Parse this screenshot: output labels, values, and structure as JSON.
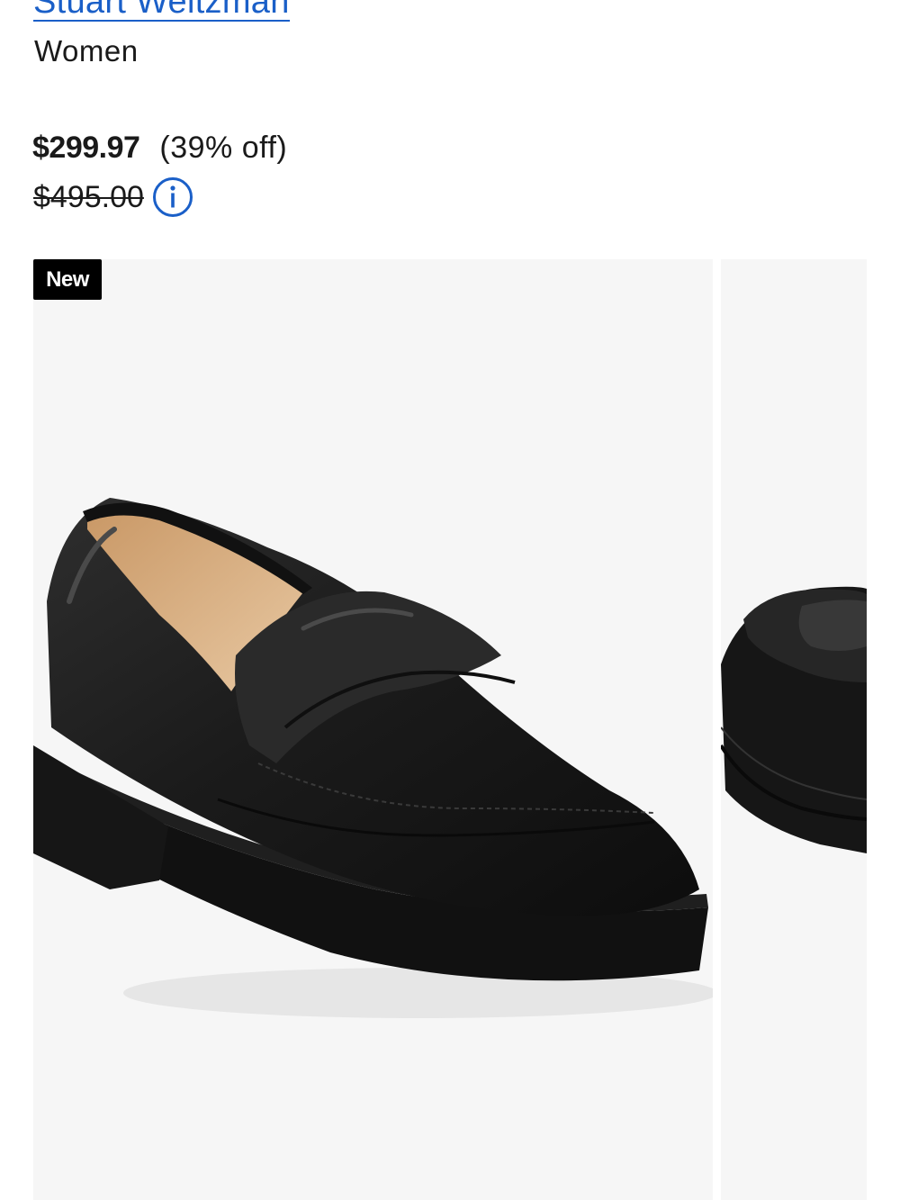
{
  "product": {
    "brand": "Stuart Weitzman",
    "category": "Women",
    "badge": "New"
  },
  "pricing": {
    "sale_price": "$299.97",
    "discount": "(39% off)",
    "original_price": "$495.00"
  },
  "gallery": {
    "images": [
      "loafer-three-quarter-view",
      "loafer-front-view"
    ],
    "current_index": 0
  },
  "colors": {
    "link": "#1a5fc8",
    "badge_bg": "#000000",
    "image_bg": "#f6f6f6"
  },
  "icons": {
    "price_info": "info-circle-icon"
  }
}
